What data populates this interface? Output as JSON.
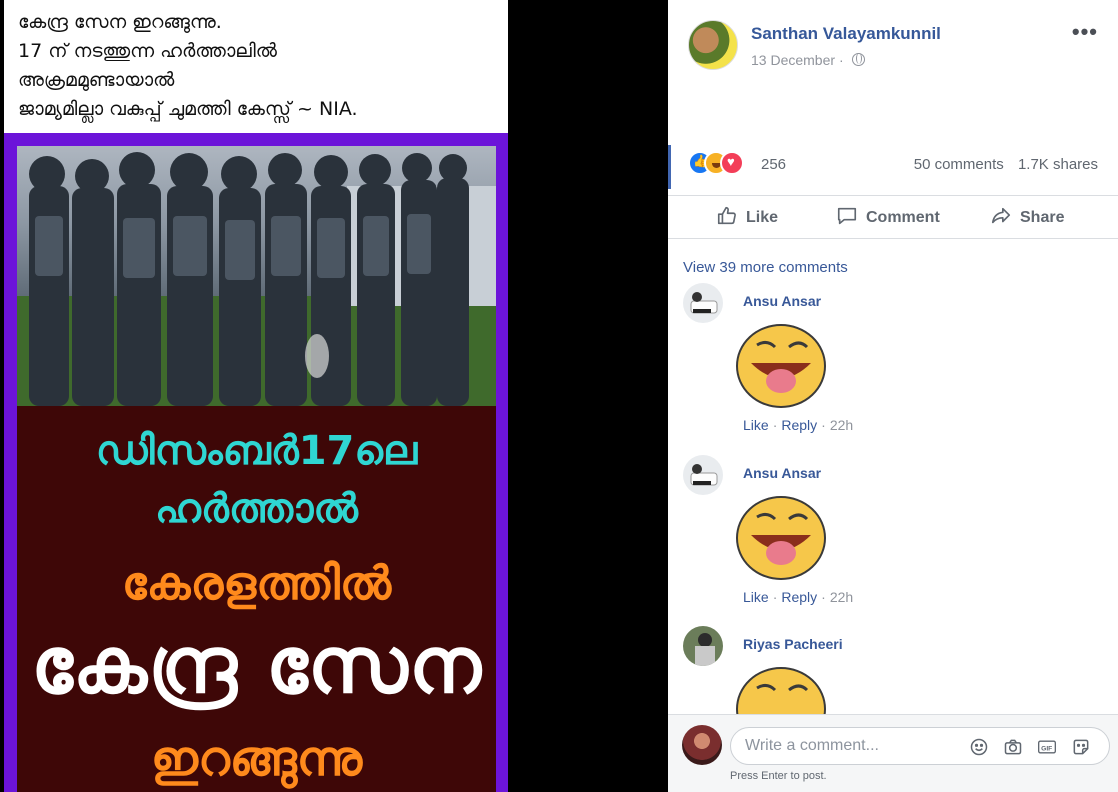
{
  "media": {
    "caption_lines": [
      "കേന്ദ്ര സേന ഇറങ്ങുന്നു.",
      "17 ന് നടത്തുന്ന ഹർത്താലിൽ",
      "അക്രമമുണ്ടായാൽ",
      "ജാമ്യമില്ലാ വകുപ്പ് ചുമത്തി കേസ്സ് ~ NIA."
    ],
    "poster_lines": [
      "ഡിസംബർ17ലെ",
      "ഹർത്താൽ",
      "കേരളത്തിൽ",
      "കേന്ദ്ര സേന",
      "ഇറങ്ങുന്നു"
    ],
    "colors": {
      "frame": "#6c14d9",
      "poster_bg": "#3e0707",
      "cyan_text": "#2fd6d2",
      "orange_text": "#ff8a1c"
    }
  },
  "post": {
    "author": "Santhan Valayamkunnil",
    "date": "13 December",
    "more_label": "•••",
    "reaction_count": "256",
    "comments_count": "50 comments",
    "shares_count": "1.7K shares",
    "actions": {
      "like": "Like",
      "comment": "Comment",
      "share": "Share"
    }
  },
  "comments": {
    "view_more": "View 39 more comments",
    "items": [
      {
        "name": "Ansu Ansar",
        "like": "Like",
        "reply": "Reply",
        "time": "22h"
      },
      {
        "name": "Ansu Ansar",
        "like": "Like",
        "reply": "Reply",
        "time": "22h"
      },
      {
        "name": "Riyas Pacheeri"
      }
    ]
  },
  "composer": {
    "placeholder": "Write a comment...",
    "hint": "Press Enter to post."
  },
  "icons": [
    "thumbs-up-icon",
    "comment-bubble-icon",
    "share-arrow-icon",
    "globe-icon",
    "emoji-icon",
    "camera-icon",
    "gif-icon",
    "sticker-icon"
  ]
}
